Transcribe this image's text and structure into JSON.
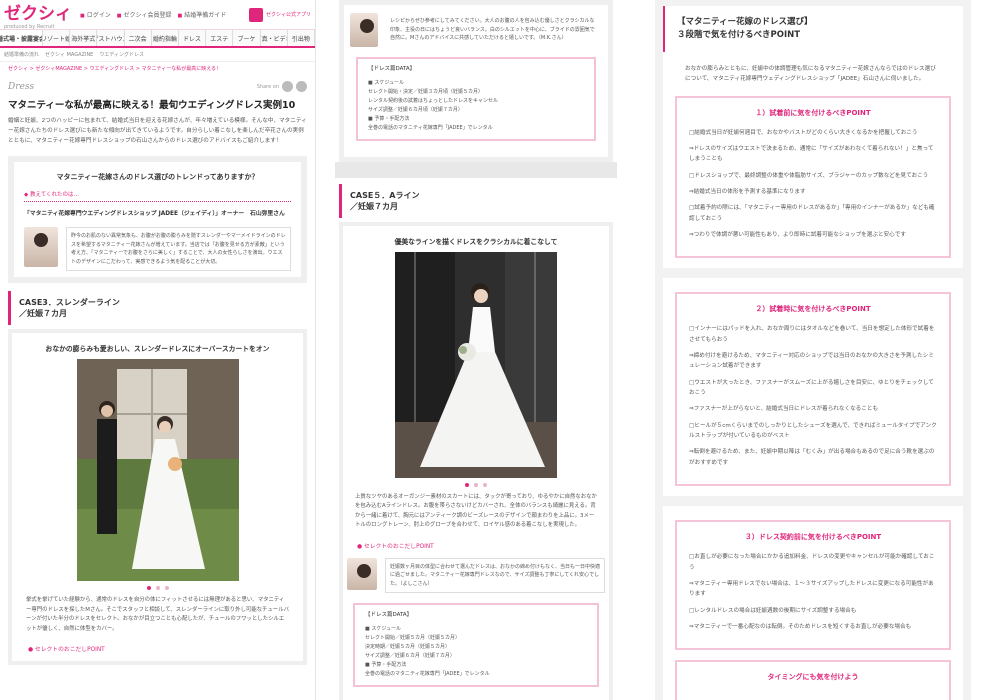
{
  "col1": {
    "logo": "ゼクシィ",
    "logo_sub": "produced by Recruit",
    "topnav": [
      "ログイン",
      "ゼクシィ会員登録",
      "結婚準備ガイド"
    ],
    "app_badge": "ゼクシィ公式アプリ",
    "menu": [
      "結婚式場・披露宴会場",
      "リゾート婚",
      "海外挙式",
      "ゲストハウス",
      "二次会",
      "婚約指輪",
      "ドレス",
      "エステ",
      "ブーケ",
      "写真・ビデオ",
      "引出物"
    ],
    "subbar": [
      "結婚準備の流れ",
      "ゼクシィ MAGAZINE",
      "ウエディングドレス"
    ],
    "breadcrumb": "ゼクシィ > ゼクシィMAGAZINE > ウエディングドレス > マタニティーな私が最高に映える！",
    "brand": "Dress",
    "share_label": "Share on",
    "title": "マタニティーな私が最高に映える！最旬ウエディングドレス実例10",
    "lede": "婚姻と妊娠、2つのハッピーに包まれて、結婚式当日を迎える花嫁さんが、年々増えている模様。そんな中、マタニティー花嫁さんたちのドレス選びにも新たな傾向が出てきているようです。自分らしい着こなしを楽しんだ卒花さんの実例とともに、マタニティー花嫁専門ドレスショップの石山さんからのドレス選びのアドバイスもご紹介します！",
    "trend_q": "マタニティー花嫁さんのドレス選びのトレンドってありますか？",
    "teacher_label": "教えてくれたのは…",
    "teacher_name": "「マタニティ花嫁専門ウエディングドレスショップ JADEE（ジェイディ）」オーナー　石山弥里さん",
    "teacher_quote": "昨今のお肌のない異常気象も、お腹がお腹の膨らみを隠すスレンダーやマーメイドラインのドレスを希望するマタニティー花嫁さんが増えています。当店では「お腹を見せる方が素敵」という考え方、「マタニティーでお腹をさらに美しく」することで、大人の女性らしさを演出。ウエストのデザインにこだわって、実感できるよう気を配ることが大切。",
    "case3_title": "CASE3．スレンダーライン",
    "case3_sub": "／妊娠７カ月",
    "case3_caption": "おなかの膨らみも愛おしい、スレンダードレスにオーバースカートをオン",
    "case3_body": "挙式を挙げていた経験から、通常のドレスを自分の体にフィットさせるには無理があると思い、マタニティー専門のドレスを探したMさん。そこでスタッフと相談して、スレンダーラインに取り外し可能なチュールバーンが付いた半分のドレスをセレクト。おなかが目立つことも心配したが、チュールのフワッとしたシルエットが優しく、自然に体型をカバー。",
    "point_link": "セレクトのおこだしPOINT"
  },
  "col2": {
    "quote_top": "レシピからぜひ参考にしてみてください。大人のお腹の人を包み込む優しさとクラシカルな印象、主役の日にはちょうど良いバランス。白のシルエットを中心に、ブライドの雰囲気で自然に。Mさんのアドバイスに共感していただけると嬉しいです。（M.K.さん）",
    "data_title": "【ドレス篇DATA】",
    "data_items": [
      "スケジュール",
      "セレクト開始・決定／妊娠３カ月頃（妊娠５カ月）",
      "レンタル契約後の試着はちょっとしたドレスをキャンセル",
      "サイズ調整／妊娠６カ月頃（妊娠７カ月）",
      "予算・手配方法",
      "全巻の電話のマタニティ花嫁専門「JADEE」でレンタル"
    ],
    "case5_title": "CASE５．Aライン",
    "case5_sub": "／妊娠７カ月",
    "case5_caption": "優美なラインを描くドレスをクラシカルに着こなして",
    "case5_body": "上質なツヤのあるオーガンジー素材のスカートには、タックが寄っており、ゆるやかに自然なおなかを包み込むAラインドレス。お腹を帯らさないけどカバーされ、全体のバランスも綺麗に見える。背から一緒に着けて、胸元にはアンティーク調のビーズレースのデザインで顔まわりを上品に。3メートルのロングトレーン、肘上のグローブを合わせて、ロイヤル感のある着こなしを実現した。",
    "point_link": "セレクトのおこだしPOINT",
    "quote_bottom": "妊娠数ヶ月目の体型に合わせて選んだドレスは、おなかの締め付けもなく、当日も一日中快適に過ごせました。マタニティー花嫁専門ドレスなので、サイズ調整も丁寧にしてくれ安心でした。（よしこさん）",
    "data2_title": "【ドレス篇DATA】",
    "data2_items": [
      "スケジュール",
      "セレクト開始／妊娠５カ月（妊娠５カ月）",
      "決定時期／妊娠５カ月（妊娠５カ月）",
      "サイズ調整／妊娠６カ月（妊娠７カ月）",
      "予算・手配方法",
      "全巻の電話のマタニティ花嫁専門「JADEE」でレンタル"
    ]
  },
  "col3": {
    "header_line1": "【マタニティー花嫁のドレス選び】",
    "header_line2": "３段階で気を付けるべきPOINT",
    "intro": "おなかの膨らみとともに、妊娠中の体調管理も気になるマタニティー花嫁さんならではのドレス選びについて、マタニティ花嫁専門ウェディングドレスショップ「JADEE」石山さんに伺いました。",
    "point1_title": "１）試着前に気を付けるべきPOINT",
    "point1_text": [
      "□結婚式当日が妊娠何週目で、おなかやバストがどのくらい大きくなるかを把握しておこう",
      "⇒ドレスのサイズはウエストで決まるため、通常に「サイズがあわなくて着られない！」と焦ってしまうことも",
      "□ドレスショップで、最終調整の体重や体脂肪サイズ、ブラジャーのカップ数などを見ておこう",
      "⇒結婚式当日の体形を予測する基準になります",
      "□試着予約の際には、「マタニティー専用のドレスがあるか」「専用のインナーがあるか」なども確認しておこう",
      "⇒つわりで体調が悪い可能性もあり、より即時に試着可能なショップを選ぶと安心です"
    ],
    "point2_title": "２）試着時に気を付けるべきPOINT",
    "point2_text": [
      "□インナーにはパッドを入れ、おなか周りにはタオルなどを巻いて、当日を想定した体形で試着をさせてもらおう",
      "⇒締め付けを避けるため、マタニティー対応のショップでは当日のおなかの大きさを予測したシミュレーション試着ができます",
      "□ウエストが大ったとき、ファスナーがスムーズに上がる嬉しさを目安に、ゆとりをチェックしておこう",
      "⇒ファスナーが上がらないと、結婚式当日にドレスが着られなくなることも",
      "□ヒールが５cmくらいまでのしっかりとしたシューズを選んで、できればミュールタイプでアンクルストラップが付いているものがベスト",
      "⇒転倒を避けるため、また、妊娠中期以降は「むくみ」が出る場合もあるので足に合う靴を選ぶのがおすすめです"
    ],
    "point3_title": "３）ドレス契約前に気を付けるべきPOINT",
    "point3_text": [
      "□お直しが必要になった場合にかかる追加料金、ドレスの変更やキャンセルが可能か確認しておこう",
      "⇒マタニティー専用ドレスでない場合は、１～３サイズアップしたドレスに変更になる可能性があります",
      "□レンタルドレスの場合は妊娠週数の後期にサイズ調整する場合も",
      "⇒マタニティーで一番心配なのは転倒。そのためドレスを短くするお直しが必要な場合も"
    ],
    "timing_link": "タイミングにも気を付けよう"
  }
}
